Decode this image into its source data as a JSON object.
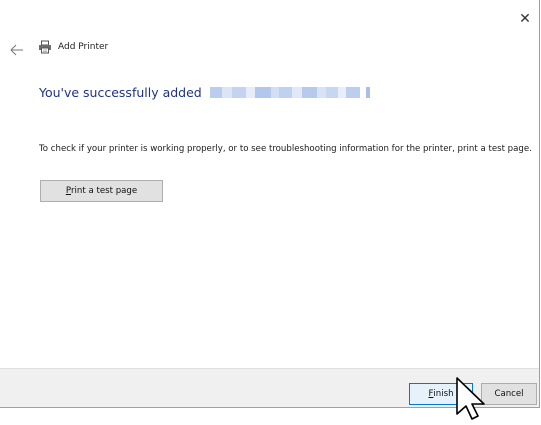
{
  "window": {
    "close_glyph": "✕"
  },
  "header": {
    "title": "Add Printer",
    "back_icon": "back-arrow-icon",
    "printer_icon": "printer-icon"
  },
  "main": {
    "heading": "You've successfully added",
    "body": "To check if your printer is working properly, or to see troubleshooting information for the printer, print a test page.",
    "test_button": {
      "mnemonic": "P",
      "rest": "rint a test page"
    }
  },
  "footer": {
    "finish": {
      "mnemonic": "F",
      "rest": "inish"
    },
    "cancel_label": "Cancel"
  },
  "colors": {
    "heading": "#1e3287",
    "footer_bg": "#f0f0f0",
    "default_button_border": "#0078d7"
  }
}
